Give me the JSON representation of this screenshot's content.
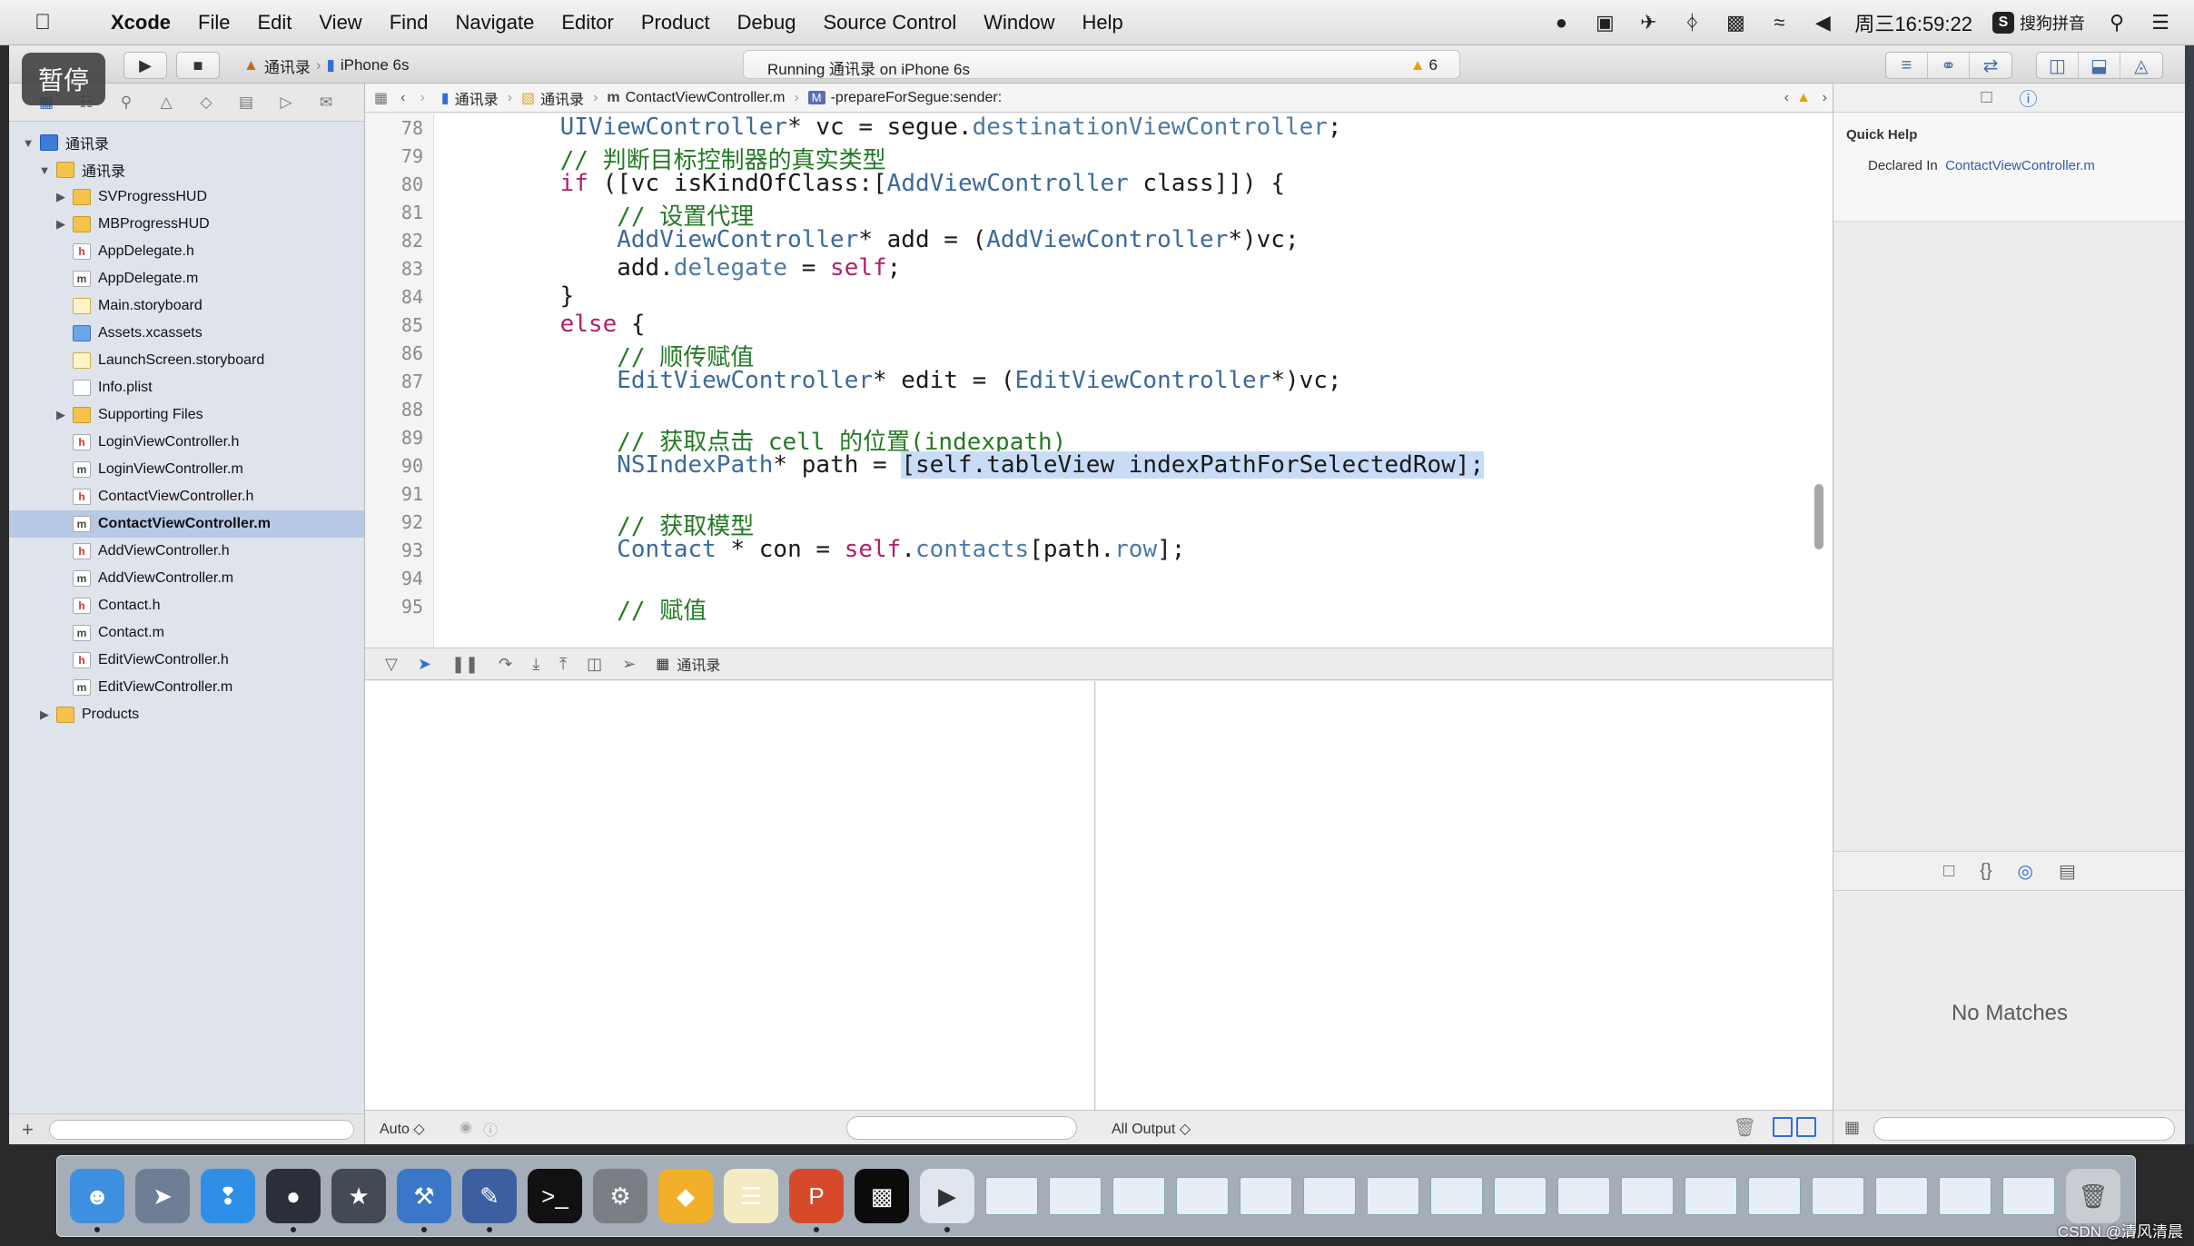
{
  "menubar": {
    "app": "Xcode",
    "items": [
      "File",
      "Edit",
      "View",
      "Find",
      "Navigate",
      "Editor",
      "Product",
      "Debug",
      "Source Control",
      "Window",
      "Help"
    ],
    "clock": "周三16:59:22",
    "ime": "搜狗拼音"
  },
  "toolbar": {
    "pause_overlay": "暂停",
    "scheme": "通讯录",
    "device": "iPhone 6s",
    "status": "Running 通讯录 on iPhone 6s",
    "warning_count": "6"
  },
  "jumpbar": {
    "crumbs": [
      "通讯录",
      "通讯录",
      "ContactViewController.m",
      "-prepareForSegue:sender:"
    ]
  },
  "navigator": {
    "items": [
      {
        "label": "通讯录",
        "type": "proj",
        "indent": 0,
        "disclosure": "open"
      },
      {
        "label": "通讯录",
        "type": "folder",
        "indent": 1,
        "disclosure": "open"
      },
      {
        "label": "SVProgressHUD",
        "type": "folder",
        "indent": 2,
        "disclosure": "closed"
      },
      {
        "label": "MBProgressHUD",
        "type": "folder",
        "indent": 2,
        "disclosure": "closed"
      },
      {
        "label": "AppDelegate.h",
        "type": "h",
        "indent": 2
      },
      {
        "label": "AppDelegate.m",
        "type": "m",
        "indent": 2
      },
      {
        "label": "Main.storyboard",
        "type": "sb",
        "indent": 2
      },
      {
        "label": "Assets.xcassets",
        "type": "assets",
        "indent": 2
      },
      {
        "label": "LaunchScreen.storyboard",
        "type": "sb",
        "indent": 2
      },
      {
        "label": "Info.plist",
        "type": "plist",
        "indent": 2
      },
      {
        "label": "Supporting Files",
        "type": "folder",
        "indent": 2,
        "disclosure": "closed"
      },
      {
        "label": "LoginViewController.h",
        "type": "h",
        "indent": 2
      },
      {
        "label": "LoginViewController.m",
        "type": "m",
        "indent": 2
      },
      {
        "label": "ContactViewController.h",
        "type": "h",
        "indent": 2
      },
      {
        "label": "ContactViewController.m",
        "type": "m",
        "indent": 2,
        "selected": true
      },
      {
        "label": "AddViewController.h",
        "type": "h",
        "indent": 2
      },
      {
        "label": "AddViewController.m",
        "type": "m",
        "indent": 2
      },
      {
        "label": "Contact.h",
        "type": "h",
        "indent": 2
      },
      {
        "label": "Contact.m",
        "type": "m",
        "indent": 2
      },
      {
        "label": "EditViewController.h",
        "type": "h",
        "indent": 2
      },
      {
        "label": "EditViewController.m",
        "type": "m",
        "indent": 2
      },
      {
        "label": "Products",
        "type": "folder",
        "indent": 1,
        "disclosure": "closed"
      }
    ]
  },
  "editor": {
    "lines": [
      {
        "n": "78",
        "tokens": [
          [
            "",
            "    "
          ],
          [
            "cls",
            "UIViewController"
          ],
          [
            "",
            "* vc = segue."
          ],
          [
            "prop",
            "destinationViewController"
          ],
          [
            "",
            ";"
          ]
        ]
      },
      {
        "n": "79",
        "tokens": [
          [
            "",
            "    "
          ],
          [
            "cmt",
            "// 判断目标控制器的真实类型"
          ]
        ]
      },
      {
        "n": "80",
        "tokens": [
          [
            "",
            "    "
          ],
          [
            "kw",
            "if"
          ],
          [
            "",
            " ([vc isKindOfClass:["
          ],
          [
            "cls",
            "AddViewController"
          ],
          [
            "",
            " class]]) {"
          ]
        ]
      },
      {
        "n": "81",
        "tokens": [
          [
            "",
            "        "
          ],
          [
            "cmt",
            "// 设置代理"
          ]
        ]
      },
      {
        "n": "82",
        "tokens": [
          [
            "",
            "        "
          ],
          [
            "cls",
            "AddViewController"
          ],
          [
            "",
            "* add = ("
          ],
          [
            "cls",
            "AddViewController"
          ],
          [
            "",
            "*)vc;"
          ]
        ]
      },
      {
        "n": "83",
        "tokens": [
          [
            "",
            "        add."
          ],
          [
            "prop",
            "delegate"
          ],
          [
            "",
            " = "
          ],
          [
            "kw",
            "self"
          ],
          [
            "",
            ";"
          ]
        ]
      },
      {
        "n": "84",
        "tokens": [
          [
            "",
            "    }"
          ]
        ]
      },
      {
        "n": "85",
        "tokens": [
          [
            "",
            "    "
          ],
          [
            "kw",
            "else"
          ],
          [
            "",
            " {"
          ]
        ]
      },
      {
        "n": "86",
        "tokens": [
          [
            "",
            "        "
          ],
          [
            "cmt",
            "// 顺传赋值"
          ]
        ]
      },
      {
        "n": "87",
        "tokens": [
          [
            "",
            "        "
          ],
          [
            "cls",
            "EditViewController"
          ],
          [
            "",
            "* edit = ("
          ],
          [
            "cls",
            "EditViewController"
          ],
          [
            "",
            "*)vc;"
          ]
        ]
      },
      {
        "n": "88",
        "tokens": [
          [
            "",
            ""
          ]
        ]
      },
      {
        "n": "89",
        "tokens": [
          [
            "",
            "        "
          ],
          [
            "cmt",
            "// 获取点击 cell 的位置(indexpath)"
          ]
        ]
      },
      {
        "n": "90",
        "tokens": [
          [
            "",
            "        "
          ],
          [
            "cls",
            "NSIndexPath"
          ],
          [
            "",
            "* path = "
          ],
          [
            "sel",
            "[self.tableView indexPathForSelectedRow];"
          ]
        ]
      },
      {
        "n": "91",
        "tokens": [
          [
            "",
            ""
          ]
        ]
      },
      {
        "n": "92",
        "tokens": [
          [
            "",
            "        "
          ],
          [
            "cmt",
            "// 获取模型"
          ]
        ]
      },
      {
        "n": "93",
        "tokens": [
          [
            "",
            "        "
          ],
          [
            "cls",
            "Contact"
          ],
          [
            "",
            " * con = "
          ],
          [
            "kw",
            "self"
          ],
          [
            "",
            "."
          ],
          [
            "prop",
            "contacts"
          ],
          [
            "",
            "[path."
          ],
          [
            "prop",
            "row"
          ],
          [
            "",
            "];"
          ]
        ]
      },
      {
        "n": "94",
        "tokens": [
          [
            "",
            ""
          ]
        ]
      },
      {
        "n": "95",
        "tokens": [
          [
            "",
            "        "
          ],
          [
            "cmt",
            "// 赋值"
          ]
        ]
      }
    ]
  },
  "debug": {
    "target": "通讯录",
    "auto_label": "Auto ◇",
    "output_label": "All Output ◇"
  },
  "inspector": {
    "quick_help_title": "Quick Help",
    "declared_in_label": "Declared In",
    "declared_in_file": "ContactViewController.m",
    "no_matches": "No Matches"
  },
  "watermark": "CSDN @清风清晨",
  "colors": {
    "selection": "#b8c9e6",
    "keyword": "#b21f6b",
    "comment": "#247a24",
    "class": "#3b6a9a",
    "accent": "#2f6fd6"
  }
}
